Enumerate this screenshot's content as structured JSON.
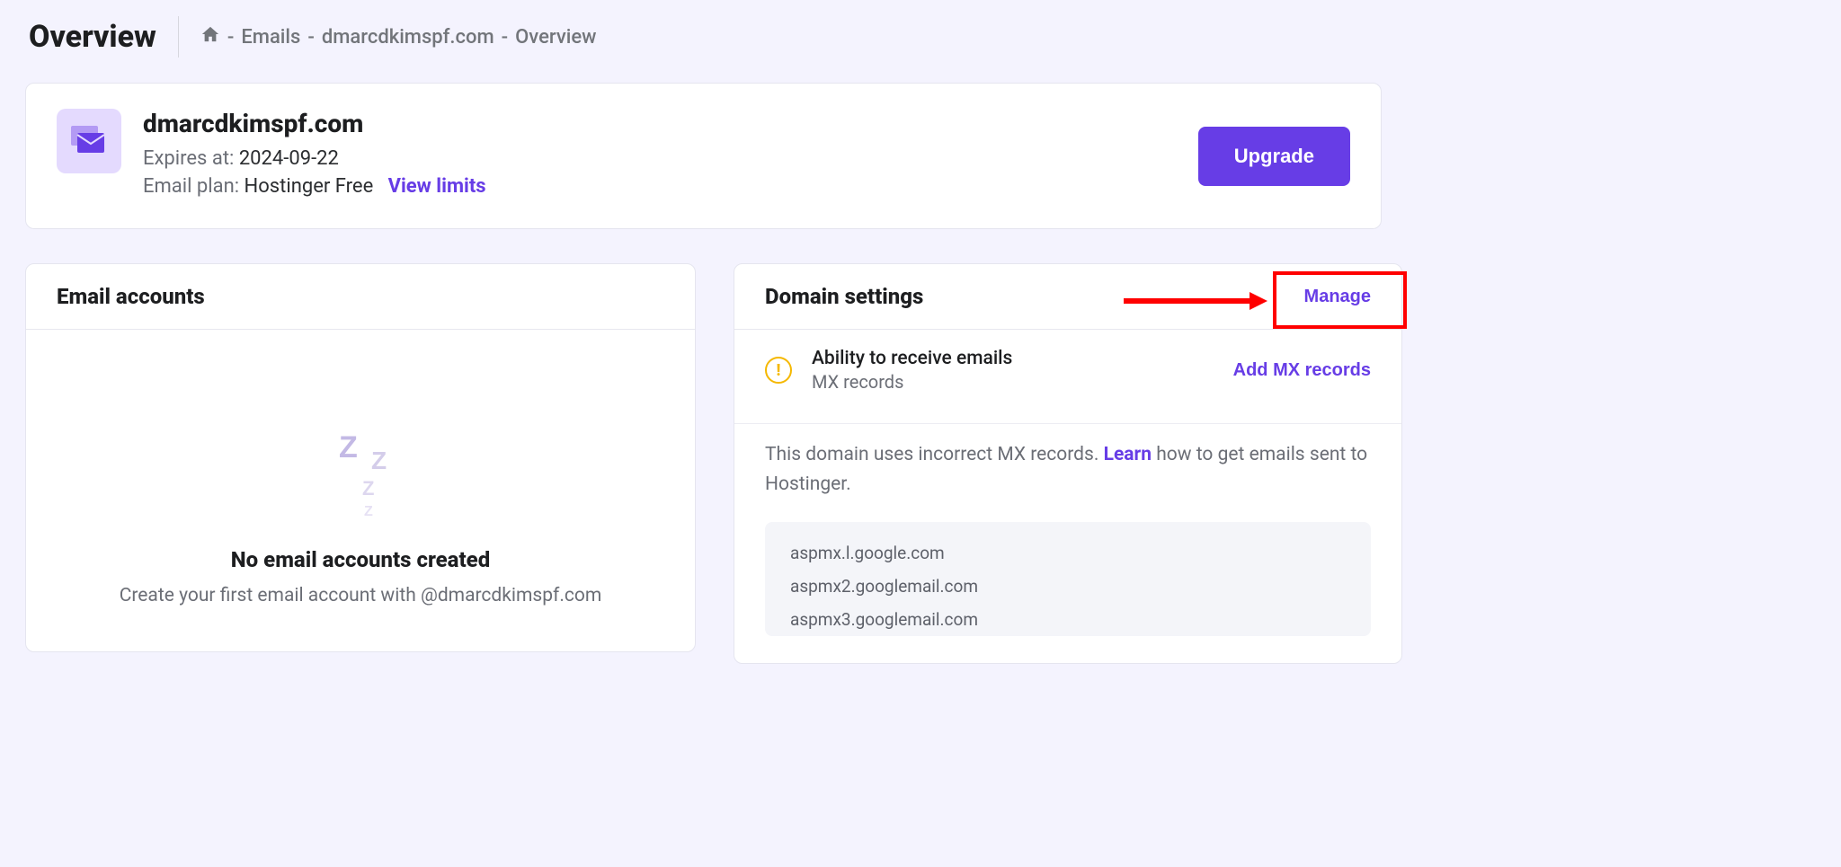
{
  "page": {
    "title": "Overview"
  },
  "breadcrumb": {
    "emails": "Emails",
    "domain": "dmarcdkimspf.com",
    "current": "Overview"
  },
  "domain_card": {
    "name": "dmarcdkimspf.com",
    "expires_label": "Expires at:",
    "expires_value": "2024-09-22",
    "plan_label": "Email plan:",
    "plan_value": "Hostinger Free",
    "view_limits": "View limits",
    "upgrade": "Upgrade"
  },
  "email_accounts": {
    "title": "Email accounts",
    "empty_title": "No email accounts created",
    "empty_sub": "Create your first email account with @dmarcdkimspf.com"
  },
  "domain_settings": {
    "title": "Domain settings",
    "manage": "Manage",
    "receive_title": "Ability to receive emails",
    "receive_sub": "MX records",
    "add_mx": "Add MX records",
    "mx_msg_1": "This domain uses incorrect MX records. ",
    "mx_learn": "Learn",
    "mx_msg_2": " how to get emails sent to Hostinger.",
    "mx_records": [
      "aspmx.l.google.com",
      "aspmx2.googlemail.com",
      "aspmx3.googlemail.com"
    ]
  }
}
